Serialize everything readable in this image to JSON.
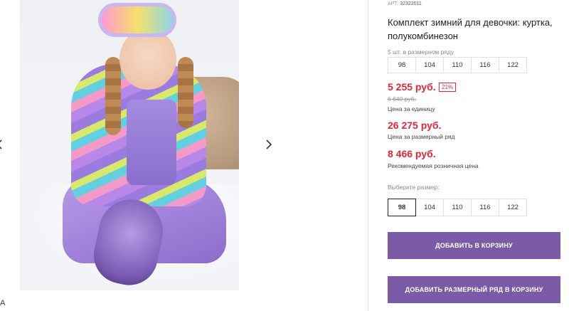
{
  "gallery": {
    "prev_icon": "chevron-left-icon",
    "next_icon": "chevron-right-icon",
    "edge_text": "A"
  },
  "product": {
    "article_label": "АРТ:",
    "article_value": "32322011",
    "title": "Комплект зимний для девочки: куртка, полукомбинезон",
    "row_label": "5 шт. в размерном ряду",
    "row_sizes": [
      "98",
      "104",
      "110",
      "116",
      "122"
    ],
    "price": "5 255 руб.",
    "discount": "21%",
    "old_price": "6 640 руб.",
    "price_note": "Цена за единицу",
    "row_price": "26 275 руб.",
    "row_price_note": "Цена за размерный ряд",
    "retail_price": "8 466 руб.",
    "retail_price_note": "Рекомендуемая розничная цена",
    "choose_size_label": "Выберите размер:",
    "choose_sizes": [
      "98",
      "104",
      "110",
      "116",
      "122"
    ],
    "selected_size": "98",
    "add_to_cart": "ДОБАВИТЬ В КОРЗИНУ",
    "add_row_to_cart": "ДОБАВИТЬ РАЗМЕРНЫЙ РЯД В КОРЗИНУ"
  },
  "colors": {
    "accent": "#7b5aa6",
    "price": "#e4263a"
  }
}
